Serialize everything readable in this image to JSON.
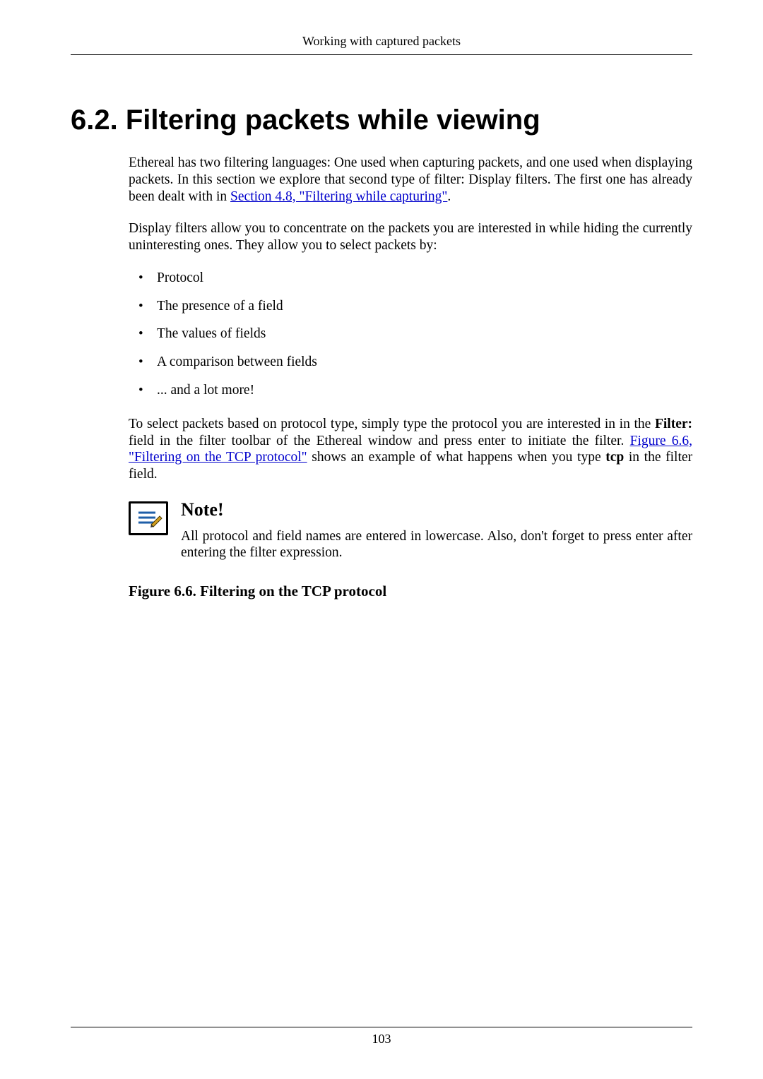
{
  "header": {
    "running_head": "Working with captured packets"
  },
  "section": {
    "title": "6.2. Filtering packets while viewing"
  },
  "paragraphs": {
    "p1_a": "Ethereal has two filtering languages: One used when capturing packets, and one used when displaying packets. In this section we explore that second type of filter: Display filters. The first one has already been dealt with in ",
    "p1_link": "Section 4.8, \"Filtering while capturing\"",
    "p1_b": ".",
    "p2": "Display filters allow you to concentrate on the packets you are interested in while hiding the currently uninteresting ones. They allow you to select packets by:",
    "p3_a": "To select packets based on protocol type, simply type the protocol you are interested in in the ",
    "p3_bold1": "Filter:",
    "p3_b": " field in the filter toolbar of the Ethereal window and press enter to initiate the filter. ",
    "p3_link": "Figure 6.6, \"Filtering on the TCP protocol\"",
    "p3_c": " shows an example of what happens when you type ",
    "p3_bold2": "tcp",
    "p3_d": " in the filter field."
  },
  "bullets": [
    "Protocol",
    "The presence of a field",
    "The values of fields",
    "A comparison between fields",
    "... and a lot more!"
  ],
  "note": {
    "heading": "Note!",
    "text": "All protocol and field names are entered in lowercase. Also, don't forget to press enter after entering the filter expression.",
    "icon_name": "note-icon"
  },
  "figure": {
    "caption": "Figure 6.6. Filtering on the TCP protocol"
  },
  "footer": {
    "page_number": "103"
  }
}
